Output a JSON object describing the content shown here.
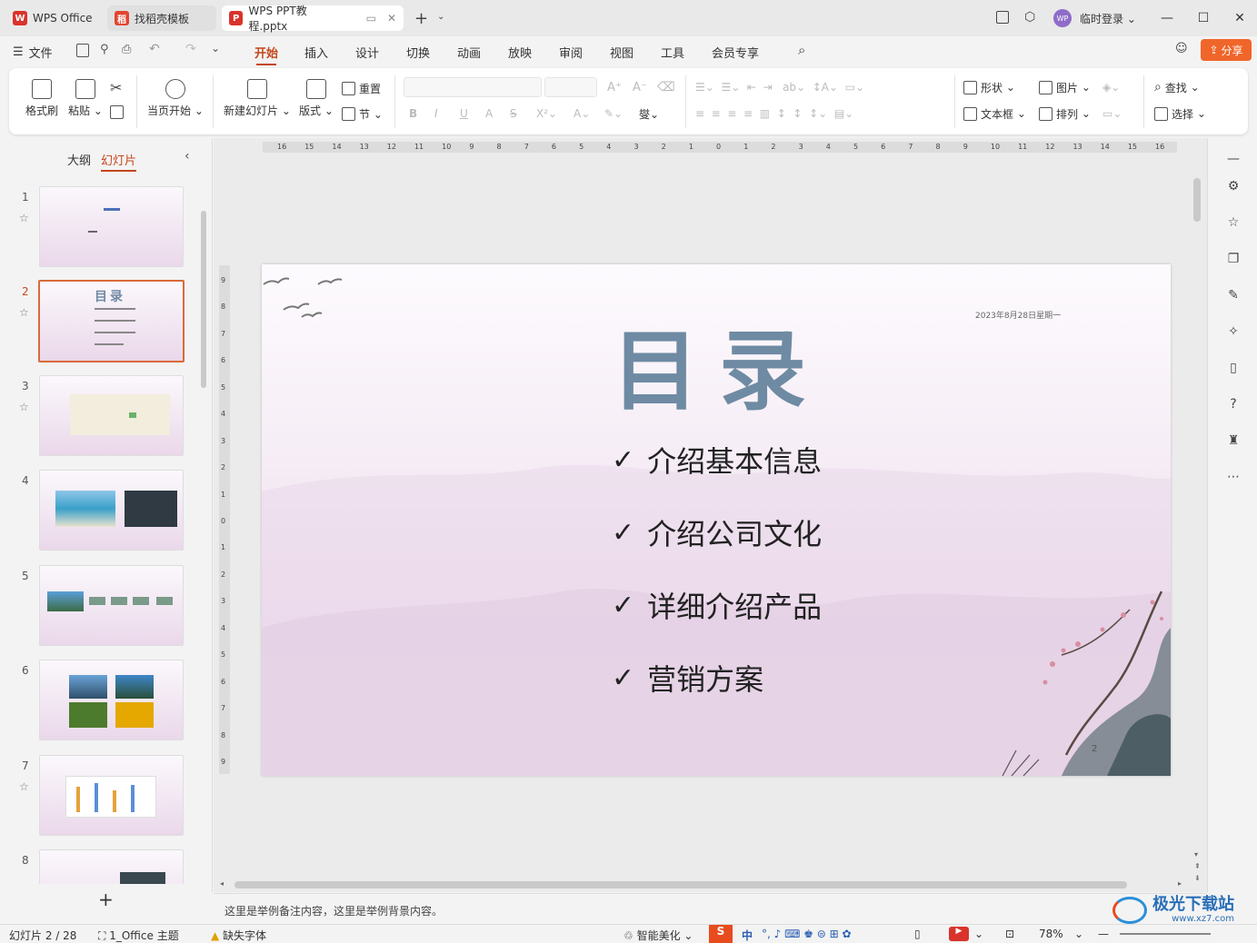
{
  "tabs": [
    {
      "label": "WPS Office",
      "icon": "wps-logo-icon"
    },
    {
      "label": "找稻壳模板",
      "icon": "docer-icon"
    },
    {
      "label": "WPS PPT教程.pptx",
      "icon": "ppt-file-icon"
    }
  ],
  "account": {
    "avatar_text": "WP",
    "login_label": "临时登录"
  },
  "menu": {
    "file": "文件",
    "items": [
      "开始",
      "插入",
      "设计",
      "切换",
      "动画",
      "放映",
      "审阅",
      "视图",
      "工具",
      "会员专享"
    ],
    "active": "开始",
    "share": "分享"
  },
  "ribbon": {
    "format_painter": "格式刷",
    "paste": "粘贴",
    "play_from_current": "当页开始",
    "new_slide": "新建幻灯片",
    "layout": "版式",
    "reset": "重置",
    "section": "节",
    "shape": "形状",
    "picture": "图片",
    "textbox": "文本框",
    "arrange": "排列",
    "find": "查找",
    "select": "选择"
  },
  "panel": {
    "tab_outline": "大纲",
    "tab_slides": "幻灯片",
    "active_tab": "幻灯片",
    "slide_numbers": [
      "1",
      "2",
      "3",
      "4",
      "5",
      "6",
      "7",
      "8"
    ],
    "active_slide": "2",
    "add_label": "+"
  },
  "ruler": {
    "h_ticks": [
      "16",
      "15",
      "14",
      "13",
      "12",
      "11",
      "10",
      "9",
      "8",
      "7",
      "6",
      "5",
      "4",
      "3",
      "2",
      "1",
      "0",
      "1",
      "2",
      "3",
      "4",
      "5",
      "6",
      "7",
      "8",
      "9",
      "10",
      "11",
      "12",
      "13",
      "14",
      "15",
      "16"
    ],
    "v_ticks": [
      "9",
      "8",
      "7",
      "6",
      "5",
      "4",
      "3",
      "2",
      "1",
      "0",
      "1",
      "2",
      "3",
      "4",
      "5",
      "6",
      "7",
      "8",
      "9"
    ]
  },
  "slide": {
    "title": "目录",
    "date": "2023年8月28日星期一",
    "items": [
      "介绍基本信息",
      "介绍公司文化",
      "详细介绍产品",
      "营销方案"
    ],
    "check": "✓",
    "page_number": "2"
  },
  "notes": {
    "text": "这里是举例备注内容，这里是举例背景内容。"
  },
  "status": {
    "slide_counter": "幻灯片 2 / 28",
    "theme": "1_Office 主题",
    "missing_font": "缺失字体",
    "smart_beautify": "智能美化",
    "ime": "中",
    "zoom": "78%"
  },
  "watermark": "极光下载站",
  "watermark_url": "www.xz7.com",
  "colors": {
    "accent": "#c4471c",
    "share": "#f0652a",
    "title": "#6f8aa3"
  }
}
